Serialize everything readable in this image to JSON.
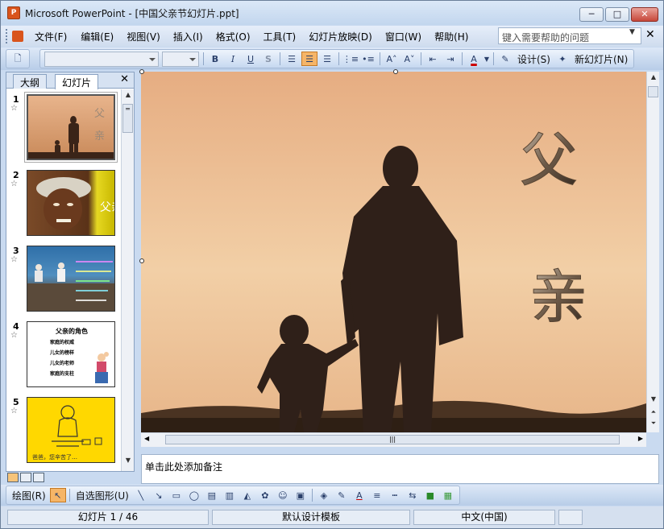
{
  "window": {
    "title": "Microsoft PowerPoint - [中国父亲节幻灯片.ppt]",
    "app_icon_text": "P"
  },
  "window_buttons": {
    "minimize": "─",
    "maximize": "□",
    "close": "✕"
  },
  "menu": {
    "items": [
      "文件(F)",
      "编辑(E)",
      "视图(V)",
      "插入(I)",
      "格式(O)",
      "工具(T)",
      "幻灯片放映(D)",
      "窗口(W)",
      "帮助(H)"
    ],
    "help_placeholder": "键入需要帮助的问题",
    "doc_close": "✕"
  },
  "toolbar": {
    "bold": "B",
    "italic": "I",
    "underline": "U",
    "shadow": "S",
    "design_label": "设计(S)",
    "new_slide_label": "新幻灯片(N)"
  },
  "left_pane": {
    "tabs": [
      "大纲",
      "幻灯片"
    ],
    "close": "✕",
    "slides": [
      {
        "number": "1",
        "star": "☆"
      },
      {
        "number": "2",
        "star": "☆",
        "text": "父亲"
      },
      {
        "number": "3",
        "star": "☆"
      },
      {
        "number": "4",
        "star": "☆",
        "title": "父亲的角色",
        "lines": [
          "家庭的权威",
          "儿女的榜样",
          "儿女的老师",
          "家庭的支柱"
        ]
      },
      {
        "number": "5",
        "star": "☆",
        "caption": "爸爸，您辛苦了…"
      }
    ]
  },
  "slide": {
    "char1": "父",
    "char2": "亲",
    "accent": "#d9a367"
  },
  "notes": {
    "placeholder": "单击此处添加备注"
  },
  "drawbar": {
    "draw_label": "绘图(R)",
    "autoshapes_label": "自选图形(U)"
  },
  "status": {
    "slide_info": "幻灯片 1 / 46",
    "template": "默认设计模板",
    "language": "中文(中国)"
  }
}
